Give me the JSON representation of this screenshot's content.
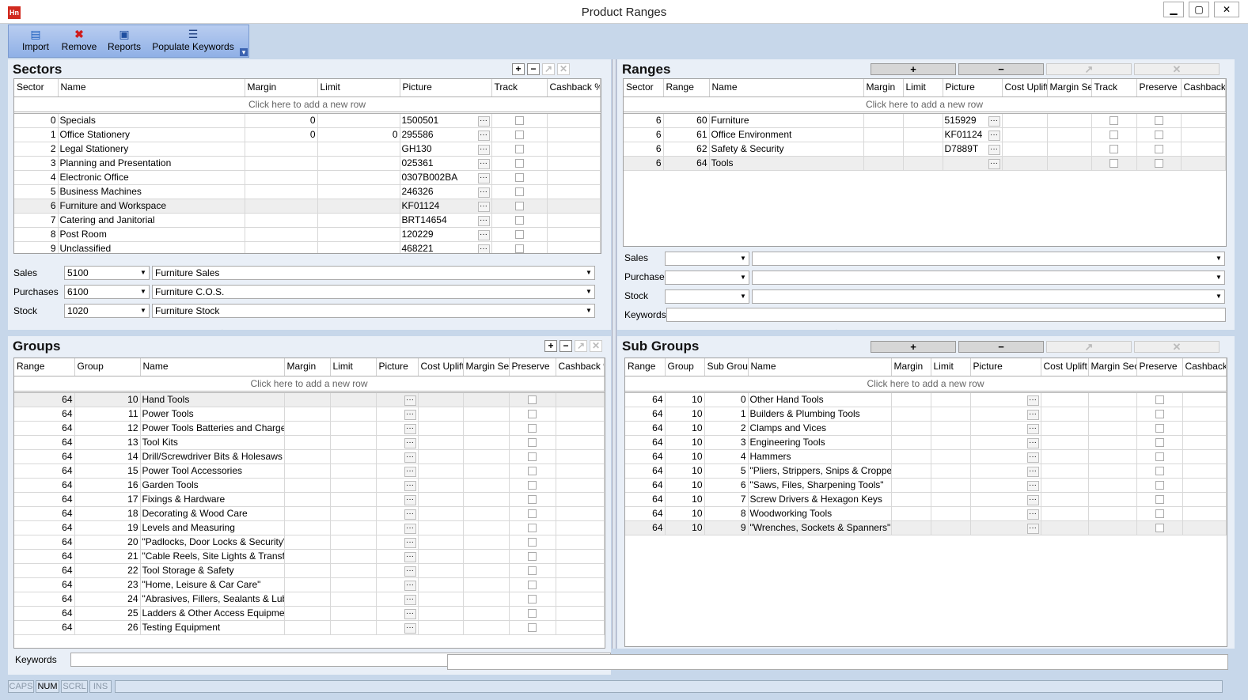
{
  "window": {
    "title": "Product Ranges",
    "icon_text": "Hn",
    "min": "▁",
    "max": "▢",
    "close": "✕"
  },
  "toolbar": {
    "items": [
      {
        "label": "Import",
        "icon": "import-icon"
      },
      {
        "label": "Remove",
        "icon": "remove-icon"
      },
      {
        "label": "Reports",
        "icon": "reports-icon"
      },
      {
        "label": "Populate Keywords",
        "icon": "list-icon"
      }
    ],
    "overflow": "▾"
  },
  "sectors": {
    "title": "Sectors",
    "add_row": "Click here to add a new row",
    "columns": [
      "Sector",
      "Name",
      "Margin",
      "Limit",
      "Picture",
      "Track",
      "Cashback %"
    ],
    "rows": [
      {
        "sector": "0",
        "name": "Specials",
        "margin": "0",
        "limit": "",
        "picture": "1500501"
      },
      {
        "sector": "1",
        "name": "Office Stationery",
        "margin": "0",
        "limit": "0",
        "picture": "295586"
      },
      {
        "sector": "2",
        "name": "Legal Stationery",
        "margin": "",
        "limit": "",
        "picture": "GH130"
      },
      {
        "sector": "3",
        "name": "Planning and Presentation",
        "margin": "",
        "limit": "",
        "picture": "025361"
      },
      {
        "sector": "4",
        "name": "Electronic Office",
        "margin": "",
        "limit": "",
        "picture": "0307B002BA"
      },
      {
        "sector": "5",
        "name": "Business Machines",
        "margin": "",
        "limit": "",
        "picture": "246326"
      },
      {
        "sector": "6",
        "name": "Furniture and Workspace",
        "margin": "",
        "limit": "",
        "picture": "KF01124"
      },
      {
        "sector": "7",
        "name": "Catering and Janitorial",
        "margin": "",
        "limit": "",
        "picture": "BRT14654"
      },
      {
        "sector": "8",
        "name": "Post Room",
        "margin": "",
        "limit": "",
        "picture": "120229"
      },
      {
        "sector": "9",
        "name": "Unclassified",
        "margin": "",
        "limit": "",
        "picture": "468221"
      }
    ],
    "accounts": [
      {
        "label": "Sales",
        "code": "5100",
        "desc": "Furniture Sales"
      },
      {
        "label": "Purchases",
        "code": "6100",
        "desc": "Furniture C.O.S."
      },
      {
        "label": "Stock",
        "code": "1020",
        "desc": "Furniture Stock"
      }
    ]
  },
  "ranges": {
    "title": "Ranges",
    "add_row": "Click here to add a new row",
    "columns": [
      "Sector",
      "Range",
      "Name",
      "Margin",
      "Limit",
      "Picture",
      "Cost Uplift",
      "Margin Security",
      "Track",
      "Preserve",
      "Cashback %"
    ],
    "rows": [
      {
        "sector": "6",
        "range": "60",
        "name": "Furniture",
        "picture": "515929"
      },
      {
        "sector": "6",
        "range": "61",
        "name": "Office Environment",
        "picture": "KF01124"
      },
      {
        "sector": "6",
        "range": "62",
        "name": "Safety & Security",
        "picture": "D7889T"
      },
      {
        "sector": "6",
        "range": "64",
        "name": "Tools",
        "picture": ""
      }
    ],
    "accounts": [
      {
        "label": "Sales"
      },
      {
        "label": "Purchases"
      },
      {
        "label": "Stock"
      }
    ],
    "keywords_label": "Keywords"
  },
  "groups": {
    "title": "Groups",
    "add_row": "Click here to add a new row",
    "columns": [
      "Range",
      "Group",
      "Name",
      "Margin",
      "Limit",
      "Picture",
      "Cost Uplift",
      "Margin Security",
      "Preserve",
      "Cashback %"
    ],
    "rows": [
      {
        "range": "64",
        "group": "10",
        "name": "Hand Tools"
      },
      {
        "range": "64",
        "group": "11",
        "name": "Power Tools"
      },
      {
        "range": "64",
        "group": "12",
        "name": "Power Tools Batteries and Chargers"
      },
      {
        "range": "64",
        "group": "13",
        "name": "Tool Kits"
      },
      {
        "range": "64",
        "group": "14",
        "name": "Drill/Screwdriver Bits & Holesaws"
      },
      {
        "range": "64",
        "group": "15",
        "name": "Power Tool Accessories"
      },
      {
        "range": "64",
        "group": "16",
        "name": "Garden Tools"
      },
      {
        "range": "64",
        "group": "17",
        "name": "Fixings & Hardware"
      },
      {
        "range": "64",
        "group": "18",
        "name": "Decorating & Wood Care"
      },
      {
        "range": "64",
        "group": "19",
        "name": "Levels and Measuring"
      },
      {
        "range": "64",
        "group": "20",
        "name": "\"Padlocks, Door Locks & Security\""
      },
      {
        "range": "64",
        "group": "21",
        "name": "\"Cable Reels, Site Lights & Transforme"
      },
      {
        "range": "64",
        "group": "22",
        "name": "Tool Storage & Safety"
      },
      {
        "range": "64",
        "group": "23",
        "name": "\"Home, Leisure & Car Care\""
      },
      {
        "range": "64",
        "group": "24",
        "name": "\"Abrasives, Fillers, Sealants & Lubrica"
      },
      {
        "range": "64",
        "group": "25",
        "name": "Ladders & Other Access Equipment"
      },
      {
        "range": "64",
        "group": "26",
        "name": "Testing Equipment"
      }
    ],
    "keywords_label": "Keywords"
  },
  "subgroups": {
    "title": "Sub Groups",
    "add_row": "Click here to add a new row",
    "columns": [
      "Range",
      "Group",
      "Sub Group",
      "Name",
      "Margin",
      "Limit",
      "Picture",
      "Cost Uplift",
      "Margin Security",
      "Preserve",
      "Cashback %"
    ],
    "rows": [
      {
        "range": "64",
        "group": "10",
        "sub": "0",
        "name": "Other Hand Tools"
      },
      {
        "range": "64",
        "group": "10",
        "sub": "1",
        "name": "Builders & Plumbing Tools"
      },
      {
        "range": "64",
        "group": "10",
        "sub": "2",
        "name": "Clamps and Vices"
      },
      {
        "range": "64",
        "group": "10",
        "sub": "3",
        "name": "Engineering Tools"
      },
      {
        "range": "64",
        "group": "10",
        "sub": "4",
        "name": "Hammers"
      },
      {
        "range": "64",
        "group": "10",
        "sub": "5",
        "name": "\"Pliers, Strippers, Snips & Croppers\""
      },
      {
        "range": "64",
        "group": "10",
        "sub": "6",
        "name": "\"Saws, Files, Sharpening Tools\""
      },
      {
        "range": "64",
        "group": "10",
        "sub": "7",
        "name": "Screw Drivers & Hexagon Keys"
      },
      {
        "range": "64",
        "group": "10",
        "sub": "8",
        "name": "Woodworking Tools"
      },
      {
        "range": "64",
        "group": "10",
        "sub": "9",
        "name": "\"Wrenches, Sockets & Spanners\""
      }
    ]
  },
  "statusbar": {
    "items": [
      "CAPS",
      "NUM",
      "SCRL",
      "INS"
    ],
    "active": "NUM"
  }
}
